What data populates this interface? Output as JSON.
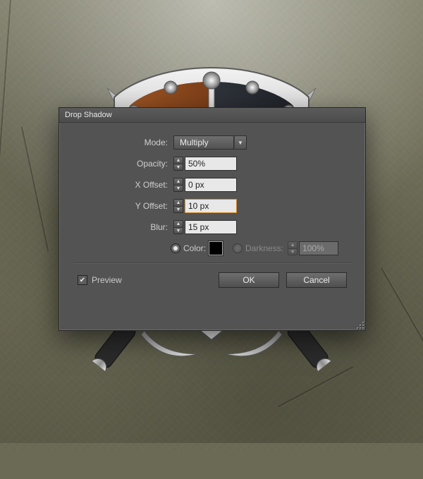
{
  "dialog": {
    "title": "Drop Shadow",
    "mode": {
      "label": "Mode:",
      "value": "Multiply"
    },
    "opacity": {
      "label": "Opacity:",
      "value": "50%"
    },
    "x_offset": {
      "label": "X Offset:",
      "value": "0 px"
    },
    "y_offset": {
      "label": "Y Offset:",
      "value": "10 px"
    },
    "blur": {
      "label": "Blur:",
      "value": "15 px"
    },
    "color_label": "Color:",
    "color_value": "#000000",
    "darkness_label": "Darkness:",
    "darkness_value": "100%",
    "preview_label": "Preview",
    "preview_checked": true,
    "ok_label": "OK",
    "cancel_label": "Cancel"
  }
}
